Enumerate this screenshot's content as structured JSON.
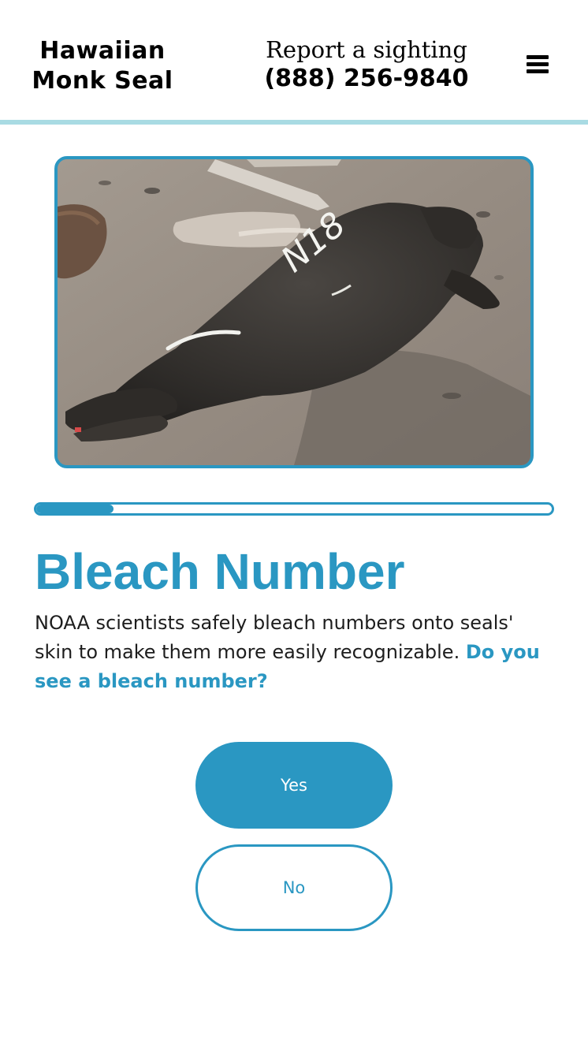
{
  "header": {
    "brand_line1": "Hawaiian",
    "brand_line2": "Monk Seal",
    "report_label": "Report a sighting",
    "report_phone": "(888) 256-9840",
    "menu_icon": "hamburger-menu-icon"
  },
  "photo": {
    "tag_text": "N18"
  },
  "progress": {
    "fraction": 0.15
  },
  "content": {
    "title": "Bleach Number",
    "description": " NOAA scientists safely bleach numbers onto seals' skin to make them more easily recognizable.",
    "question": "Do you see a bleach number?"
  },
  "buttons": {
    "yes_label": "Yes",
    "no_label": "No"
  },
  "colors": {
    "accent": "#2a97c2",
    "header_bar": "#a9dbe3"
  }
}
